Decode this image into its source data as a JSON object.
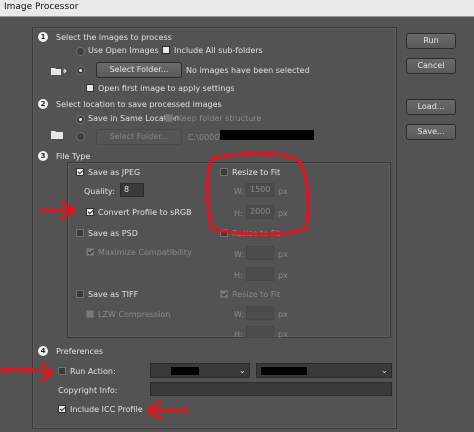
{
  "window": {
    "title": "Image Processor"
  },
  "section1": {
    "number": "1",
    "heading": "Select the images to process",
    "use_open_images": "Use Open Images",
    "include_subfolders": "Include All sub-folders",
    "select_folder_button": "Select Folder...",
    "status": "No images have been selected",
    "open_first_image": "Open first image to apply settings"
  },
  "section2": {
    "number": "2",
    "heading": "Select location to save processed images",
    "save_same_location": "Save in Same Location",
    "keep_folder_structure": "Keep folder structure",
    "select_folder_button": "Select Folder...",
    "path_prefix": "C:\\0000\\"
  },
  "section3": {
    "number": "3",
    "heading": "File Type",
    "save_as_jpeg": "Save as JPEG",
    "quality_label": "Quality:",
    "quality_value": "8",
    "convert_profile": "Convert Profile to sRGB",
    "resize_to_fit": "Resize to Fit",
    "w_label": "W:",
    "w_value": "1500",
    "h_label": "H:",
    "h_value": "2000",
    "px": "px",
    "save_as_psd": "Save as PSD",
    "maximize_compat": "Maximize Compatibility",
    "save_as_tiff": "Save as TIFF",
    "lzw_compression": "LZW Compression"
  },
  "section4": {
    "number": "4",
    "heading": "Preferences",
    "run_action": "Run Action:",
    "copyright_label": "Copyright Info:",
    "include_icc": "Include ICC Profile"
  },
  "buttons": {
    "run": "Run",
    "cancel": "Cancel",
    "load": "Load...",
    "save": "Save..."
  },
  "annotation_color": "#e8101a"
}
